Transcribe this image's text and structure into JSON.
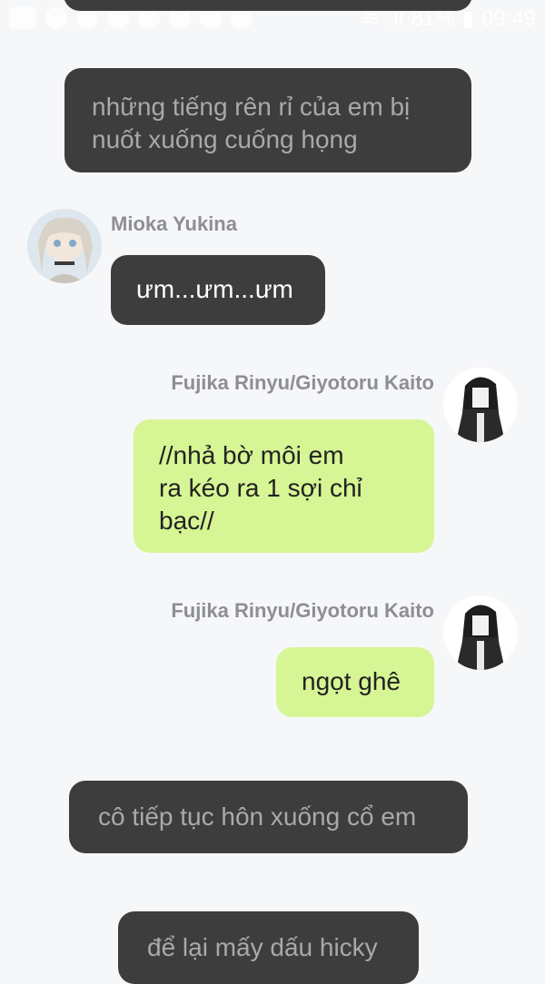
{
  "status_bar": {
    "battery": "81%",
    "time": "09:49"
  },
  "messages": [
    {
      "text": "những tiếng rên rỉ của em bị\nnuốt xuống cuống họng"
    },
    {
      "sender": "Mioka Yukina",
      "text": "ưm...ưm...ưm"
    },
    {
      "sender": "Fujika Rinyu/Giyotoru Kaito",
      "text": "//nhả bờ môi em\nra kéo ra 1 sợi chỉ\nbạc//"
    },
    {
      "sender": "Fujika Rinyu/Giyotoru Kaito",
      "text": "ngọt ghê"
    },
    {
      "text": "cô tiếp tục hôn xuống cổ em"
    },
    {
      "text": "để lại mấy dấu hicky"
    }
  ],
  "colors": {
    "background": "#f6f7f9",
    "dark_bubble": "#3d3d3d",
    "green_bubble": "#d6f594",
    "name_text": "#8e8f94"
  }
}
